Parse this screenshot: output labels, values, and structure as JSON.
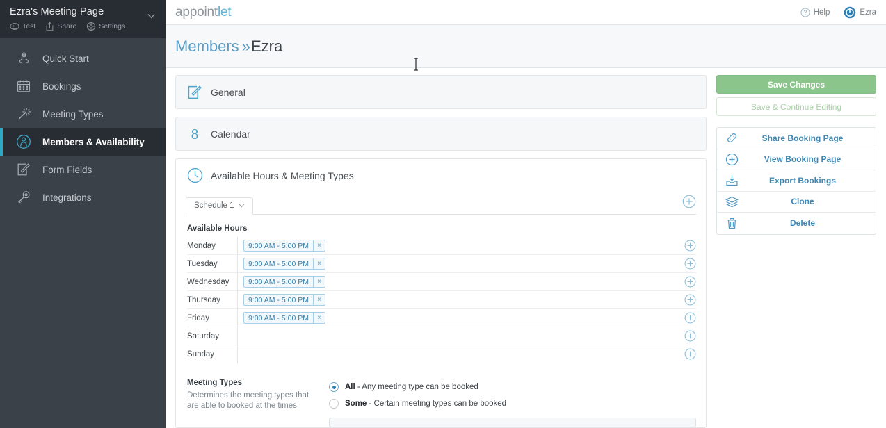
{
  "sidebar": {
    "page_title": "Ezra's Meeting Page",
    "chevron_icon": "chevron-down-icon",
    "actions": [
      {
        "label": "Test",
        "icon": "test-icon"
      },
      {
        "label": "Share",
        "icon": "share-icon"
      },
      {
        "label": "Settings",
        "icon": "gear-icon"
      }
    ],
    "items": [
      {
        "label": "Quick Start",
        "icon": "rocket-icon",
        "active": false
      },
      {
        "label": "Bookings",
        "icon": "calendar-icon",
        "active": false
      },
      {
        "label": "Meeting Types",
        "icon": "magic-wand-icon",
        "active": false
      },
      {
        "label": "Members & Availability",
        "icon": "person-circle-icon",
        "active": true
      },
      {
        "label": "Form Fields",
        "icon": "pencil-square-icon",
        "active": false
      },
      {
        "label": "Integrations",
        "icon": "key-icon",
        "active": false
      }
    ]
  },
  "topbar": {
    "logo_first": "appoint",
    "logo_second": "let",
    "help_label": "Help",
    "help_icon": "question-circle-icon",
    "user_label": "Ezra",
    "user_icon": "user-avatar-icon"
  },
  "breadcrumb": {
    "parent": "Members",
    "separator": "»",
    "current": "Ezra"
  },
  "cards": [
    {
      "title": "General",
      "icon": "pencil-square-icon"
    },
    {
      "title": "Calendar",
      "icon": "google-calendar-icon"
    },
    {
      "title": "Available Hours & Meeting Types",
      "icon": "clock-icon"
    }
  ],
  "schedule": {
    "tab_label": "Schedule 1",
    "tab_caret_icon": "chevron-down-icon",
    "add_schedule_icon": "plus-circle-icon",
    "available_hours_title": "Available Hours",
    "add_slot_icon": "plus-circle-icon",
    "remove_slot_label": "×",
    "days": [
      {
        "day": "Monday",
        "slots": [
          "9:00 AM - 5:00 PM"
        ]
      },
      {
        "day": "Tuesday",
        "slots": [
          "9:00 AM - 5:00 PM"
        ]
      },
      {
        "day": "Wednesday",
        "slots": [
          "9:00 AM - 5:00 PM"
        ]
      },
      {
        "day": "Thursday",
        "slots": [
          "9:00 AM - 5:00 PM"
        ]
      },
      {
        "day": "Friday",
        "slots": [
          "9:00 AM - 5:00 PM"
        ]
      },
      {
        "day": "Saturday",
        "slots": []
      },
      {
        "day": "Sunday",
        "slots": []
      }
    ]
  },
  "meeting_types": {
    "heading": "Meeting Types",
    "description": "Determines the meeting types that are able to booked at the times",
    "options": [
      {
        "bold": "All",
        "rest": " - Any meeting type can be booked",
        "selected": true
      },
      {
        "bold": "Some",
        "rest": " - Certain meeting types can be booked",
        "selected": false
      }
    ]
  },
  "right_panel": {
    "save_label": "Save Changes",
    "continue_label": "Save & Continue Editing",
    "actions": [
      {
        "label": "Share Booking Page",
        "icon": "link-icon"
      },
      {
        "label": "View Booking Page",
        "icon": "plus-circle-icon"
      },
      {
        "label": "Export Bookings",
        "icon": "export-icon"
      },
      {
        "label": "Clone",
        "icon": "layers-icon"
      },
      {
        "label": "Delete",
        "icon": "trash-icon"
      }
    ]
  },
  "colors": {
    "sidebar_bg": "#3b4148",
    "sidebar_head_bg": "#282d33",
    "accent_cyan": "#2aa8c4",
    "link_blue": "#3e87b5",
    "save_green": "#8cc58c"
  }
}
